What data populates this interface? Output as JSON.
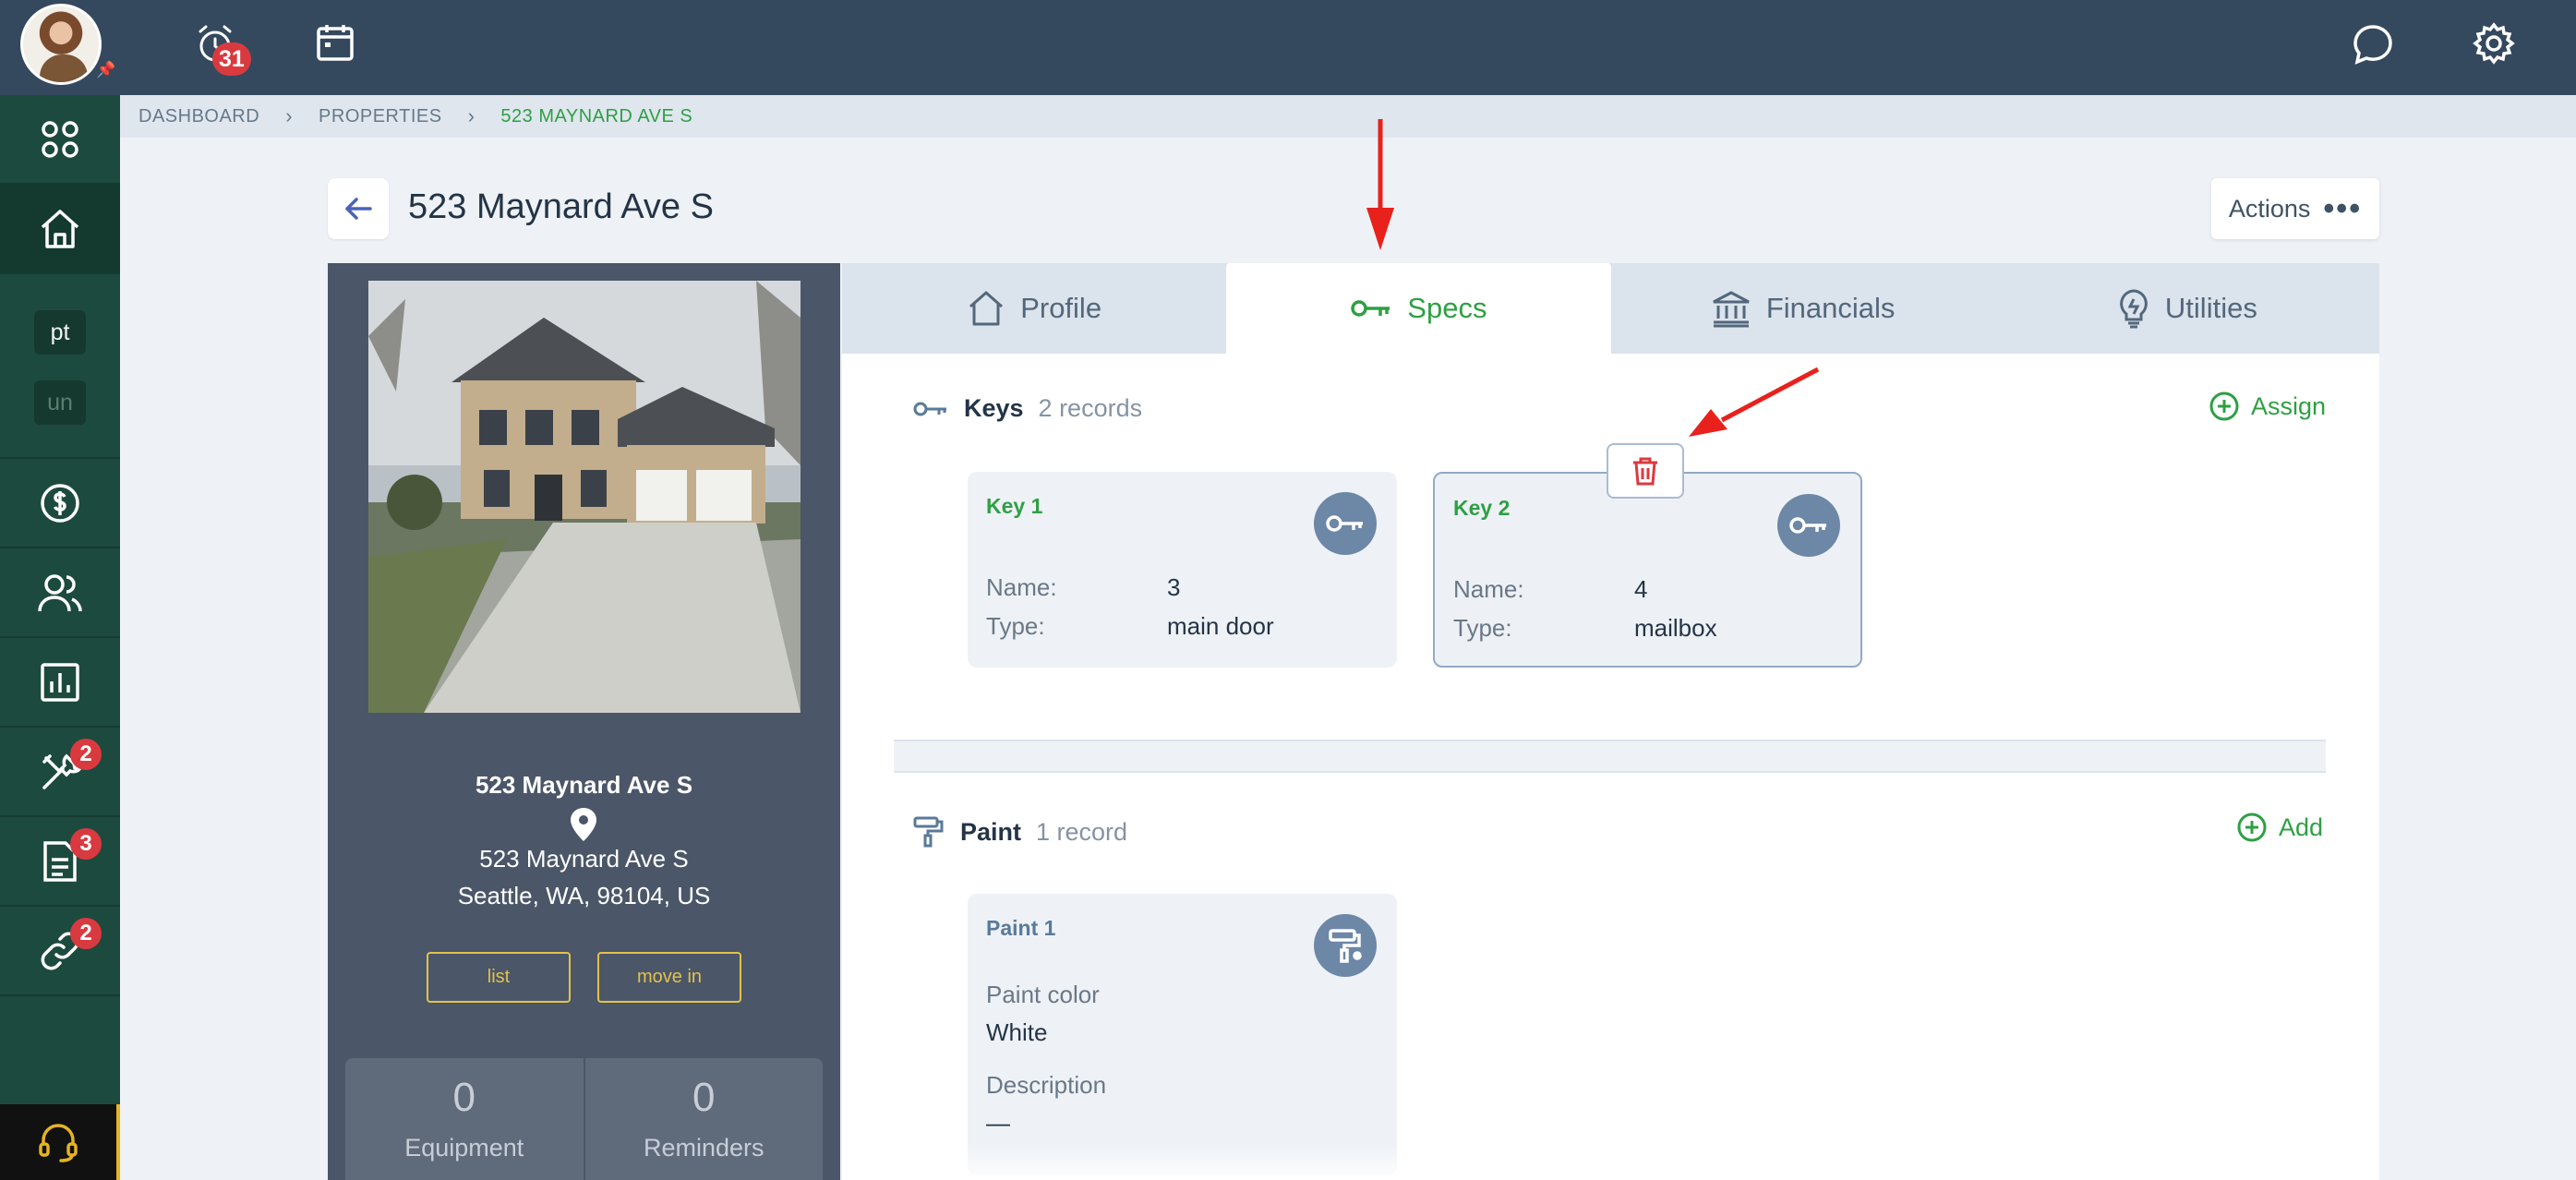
{
  "topbar": {
    "alarm_badge": "31"
  },
  "sidebar": {
    "pills": [
      "pt",
      "un"
    ],
    "badges": {
      "tools": "2",
      "documents": "3",
      "links": "2"
    }
  },
  "breadcrumb": [
    "DASHBOARD",
    "PROPERTIES",
    "523 MAYNARD AVE S"
  ],
  "page": {
    "title": "523 Maynard Ave S",
    "actions_label": "Actions"
  },
  "property": {
    "name": "523 Maynard Ave S",
    "address_line1": "523 Maynard Ave S",
    "address_line2": "Seattle, WA, 98104, US",
    "buttons": [
      "list",
      "move in"
    ],
    "stats": [
      {
        "value": "0",
        "label": "Equipment"
      },
      {
        "value": "0",
        "label": "Reminders"
      }
    ]
  },
  "tabs": [
    {
      "label": "Profile",
      "icon": "house-icon"
    },
    {
      "label": "Specs",
      "icon": "key-icon",
      "active": true
    },
    {
      "label": "Financials",
      "icon": "bank-icon"
    },
    {
      "label": "Utilities",
      "icon": "lightbulb-icon"
    }
  ],
  "keys": {
    "title": "Keys",
    "count": "2 records",
    "action": "Assign",
    "cards": [
      {
        "title": "Key 1",
        "name_label": "Name:",
        "name": "3",
        "type_label": "Type:",
        "type": "main door"
      },
      {
        "title": "Key 2",
        "name_label": "Name:",
        "name": "4",
        "type_label": "Type:",
        "type": "mailbox"
      }
    ]
  },
  "paint": {
    "title": "Paint",
    "count": "1 record",
    "action": "Add",
    "cards": [
      {
        "title": "Paint 1",
        "color_label": "Paint color",
        "color": "White",
        "desc_label": "Description",
        "desc": "—"
      }
    ]
  },
  "colors": {
    "topbar": "#34495e",
    "sidebar": "#1d4a3e",
    "accent_green": "#2ea043",
    "badge_red": "#d93a3f",
    "annotation_red": "#e8211d"
  }
}
